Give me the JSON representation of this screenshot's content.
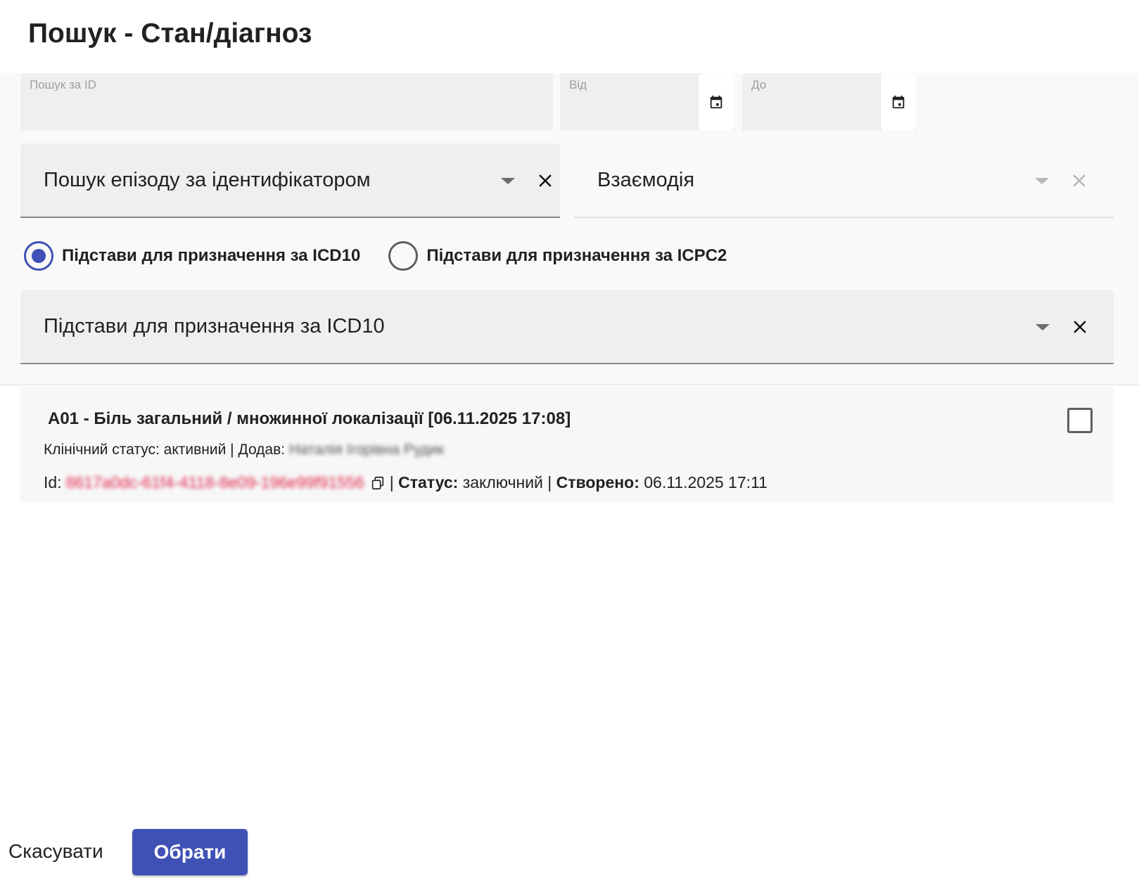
{
  "dialog": {
    "title": "Пошук - Стан/діагноз"
  },
  "filters": {
    "id_search": {
      "label": "Пошук за ID",
      "value": ""
    },
    "date_from": {
      "label": "Від",
      "value": ""
    },
    "date_to": {
      "label": "До",
      "value": ""
    },
    "episode_select": {
      "value": "Пошук епізоду за ідентифікатором"
    },
    "interaction_select": {
      "value": "Взаємодія"
    },
    "basis_radio": {
      "options": [
        {
          "label": "Підстави для призначення за ICD10",
          "selected": true
        },
        {
          "label": "Підстави для призначення за ICPC2",
          "selected": false
        }
      ]
    },
    "basis_select": {
      "value": "Підстави для призначення за ICD10"
    }
  },
  "results": [
    {
      "title": "A01 - Біль загальний / множинної локалізації [06.11.2025 17:08]",
      "clinical_status_label": "Клінічний статус:",
      "clinical_status": "активний",
      "added_by_label": "Додав:",
      "added_by": "Наталія Ігорівна Рудик",
      "id_label": "Id:",
      "id_value": "8617a0dc-61f4-4118-8e09-196e99f91556",
      "status_label": "Статус:",
      "status": "заключний",
      "created_label": "Створено:",
      "created": "06.11.2025 17:11",
      "checked": false
    }
  ],
  "footer": {
    "cancel_label": "Скасувати",
    "select_label": "Обрати"
  },
  "colors": {
    "primary": "#3f51b5",
    "id_text": "#e0244a"
  }
}
